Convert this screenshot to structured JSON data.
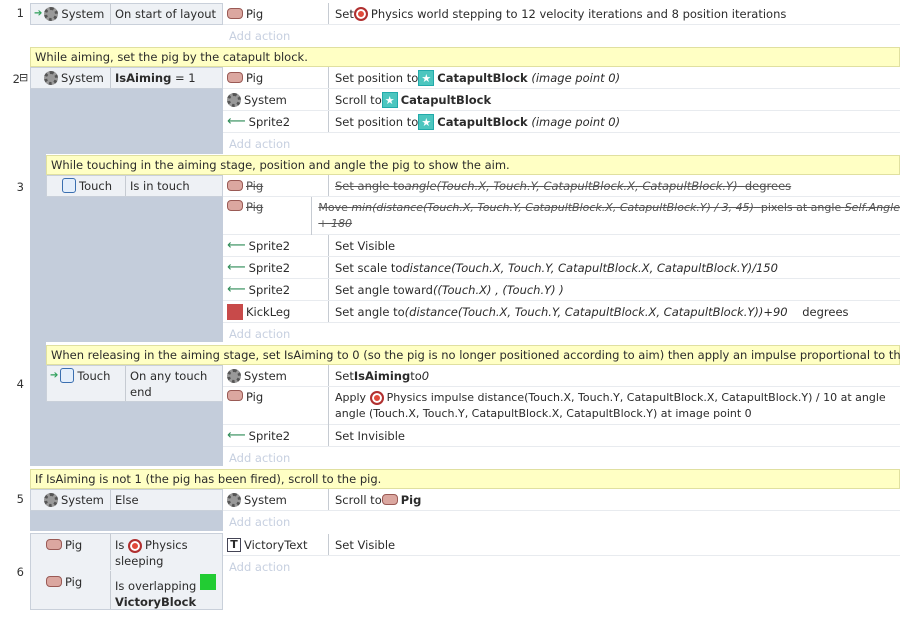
{
  "events": [
    {
      "num": "1",
      "conditions": [
        {
          "object": "System",
          "icon": "gear-icon",
          "text": "On start of layout"
        }
      ],
      "actions": [
        {
          "object": "Pig",
          "icon": "pig-icon",
          "parts": [
            "Set ",
            "Physics world stepping to 12 velocity iterations and 8 position iterations"
          ]
        }
      ]
    },
    {
      "num": "2",
      "comment": "While aiming, set the pig by the catapult block.",
      "conditions": [
        {
          "object": "System",
          "icon": "gear-icon",
          "text": "IsAiming",
          "value": "= 1"
        }
      ],
      "actions": [
        {
          "object": "Pig",
          "label": "Set position to ",
          "target": "CatapultBlock",
          "suffix": "(image point 0)"
        },
        {
          "object": "System",
          "label": "Scroll to ",
          "target": "CatapultBlock"
        },
        {
          "object": "Sprite2",
          "label": "Set position to ",
          "target": "CatapultBlock",
          "suffix": "(image point 0)"
        }
      ]
    },
    {
      "num": "3",
      "comment": "While touching in the aiming stage, position and angle the pig to show the aim.",
      "conditions": [
        {
          "object": "Touch",
          "icon": "touch-icon",
          "text": "Is in touch"
        }
      ],
      "actions": [
        {
          "object": "Pig",
          "label": "Set angle to ",
          "expr": "angle(Touch.X, Touch.Y, CatapultBlock.X, CatapultBlock.Y)",
          "suffix": "degrees"
        },
        {
          "object": "Pig",
          "label": "Move ",
          "expr": "min(distance(Touch.X, Touch.Y, CatapultBlock.X, CatapultBlock.Y) / 3, 45)",
          "mid": "pixels at angle ",
          "expr2": "Self.Angle",
          "line2": "+ 180"
        },
        {
          "object": "Sprite2",
          "label": "Set Visible"
        },
        {
          "object": "Sprite2",
          "label": "Set scale to ",
          "expr": "distance(Touch.X, Touch.Y, CatapultBlock.X, CatapultBlock.Y)/150"
        },
        {
          "object": "Sprite2",
          "label": "Set angle toward ",
          "expr": "((Touch.X) , (Touch.Y) )"
        },
        {
          "object": "KickLeg",
          "label": "Set angle to ",
          "expr": "(distance(Touch.X, Touch.Y, CatapultBlock.X, CatapultBlock.Y))+90",
          "suffix": "degrees"
        }
      ]
    },
    {
      "num": "4",
      "comment": "When releasing in the aiming stage, set IsAiming to 0 (so the pig is no longer positioned according to aim) then apply an impulse proportional to the aim.",
      "conditions": [
        {
          "object": "Touch",
          "text": "On any touch",
          "text2": "end"
        }
      ],
      "actions": [
        {
          "object": "System",
          "label": "Set ",
          "target": "IsAiming",
          "mid": " to ",
          "expr": "0"
        },
        {
          "object": "Pig",
          "label": "Apply ",
          "line1": "Physics impulse distance(Touch.X, Touch.Y, CatapultBlock.X, CatapultBlock.Y) / 10 at angle",
          "line2": "angle (Touch.X, Touch.Y, CatapultBlock.X, CatapultBlock.Y) at image point 0"
        },
        {
          "object": "Sprite2",
          "label": "Set Invisible"
        }
      ]
    },
    {
      "num": "5",
      "comment": "If IsAiming is not 1 (the pig has been fired), scroll to the pig.",
      "conditions": [
        {
          "object": "System",
          "text": "Else"
        }
      ],
      "actions": [
        {
          "object": "System",
          "label": "Scroll to ",
          "target": "Pig"
        }
      ]
    },
    {
      "num": "6",
      "conditions": [
        {
          "object": "Pig",
          "text": "Is ",
          "text_b": "Physics",
          "text2": "sleeping"
        },
        {
          "object": "Pig",
          "text": "Is overlapping",
          "target": "VictoryBlock"
        }
      ],
      "actions": [
        {
          "object": "VictoryText",
          "label": "Set Visible"
        }
      ]
    }
  ],
  "add_action": "Add action",
  "collapse_marker": "⊟"
}
